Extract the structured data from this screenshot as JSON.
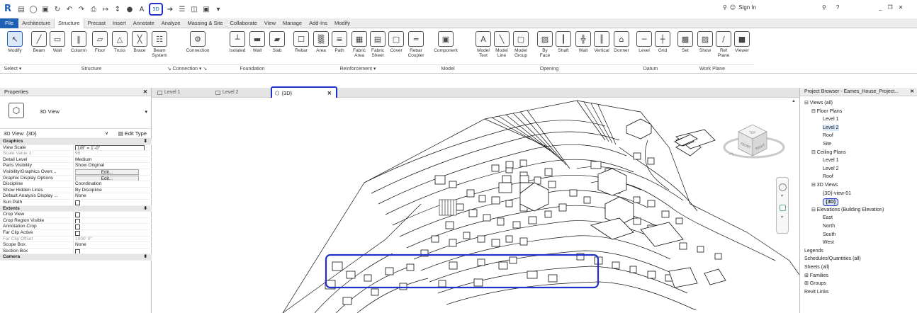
{
  "app": {
    "logo": "R",
    "qa_highlight": "3D",
    "help": "?",
    "sign_in": "Sign In",
    "window_controls": [
      "_",
      "❐",
      "✕"
    ]
  },
  "tabs": [
    "Architecture",
    "Structure",
    "Precast",
    "Insert",
    "Annotate",
    "Analyze",
    "Massing & Site",
    "Collaborate",
    "View",
    "Manage",
    "Add-Ins",
    "Modify"
  ],
  "file_tab": "File",
  "active_tab": "Structure",
  "ribbon": {
    "items": [
      {
        "label": "Modify",
        "icon": "↖"
      },
      {
        "label": "Beam",
        "icon": "╱"
      },
      {
        "label": "Wall",
        "icon": "▭"
      },
      {
        "label": "Column",
        "icon": "‖"
      },
      {
        "label": "Floor",
        "icon": "▱"
      },
      {
        "label": "Truss",
        "icon": "△"
      },
      {
        "label": "Brace",
        "icon": "╳"
      },
      {
        "label": "Beam\nSystem",
        "icon": "☷"
      },
      {
        "label": "Connection",
        "icon": "⚙"
      },
      {
        "label": "Isolated",
        "icon": "┴"
      },
      {
        "label": "Wall",
        "icon": "▬"
      },
      {
        "label": "Slab",
        "icon": "▰"
      },
      {
        "label": "Rebar",
        "icon": "☐"
      },
      {
        "label": "Area",
        "icon": "▒"
      },
      {
        "label": "Path",
        "icon": "≡"
      },
      {
        "label": "Fabric\nArea",
        "icon": "▦"
      },
      {
        "label": "Fabric\nSheet",
        "icon": "▤"
      },
      {
        "label": "Cover",
        "icon": "□"
      },
      {
        "label": "Rebar\nCoupler",
        "icon": "═"
      },
      {
        "label": "Component",
        "icon": "▣"
      },
      {
        "label": "Model\nText",
        "icon": "A"
      },
      {
        "label": "Model\nLine",
        "icon": "╲"
      },
      {
        "label": "Model\nGroup",
        "icon": "▢"
      },
      {
        "label": "By\nFace",
        "icon": "▧"
      },
      {
        "label": "Shaft",
        "icon": "┃"
      },
      {
        "label": "Wall",
        "icon": "╬"
      },
      {
        "label": "Vertical",
        "icon": "║"
      },
      {
        "label": "Dormer",
        "icon": "⌂"
      },
      {
        "label": "Level",
        "icon": "─"
      },
      {
        "label": "Grid",
        "icon": "┼"
      },
      {
        "label": "Set",
        "icon": "▩"
      },
      {
        "label": "Show",
        "icon": "▨"
      },
      {
        "label": "Ref\nPlane",
        "icon": "∕"
      },
      {
        "label": "Viewer",
        "icon": "■"
      }
    ],
    "groups": [
      {
        "label": "Select ▾"
      },
      {
        "label": "Structure"
      },
      {
        "label": "↘ Connection ▾ ↘"
      },
      {
        "label": "Foundation"
      },
      {
        "label": "Reinforcement ▾"
      },
      {
        "label": "Model"
      },
      {
        "label": "Opening"
      },
      {
        "label": "Datum"
      },
      {
        "label": "Work Plane"
      }
    ]
  },
  "properties": {
    "title": "Properties",
    "close": "✕",
    "type_name": "3D View",
    "instance": "3D View: {3D}",
    "edit_type": "Edit Type",
    "rows": [
      {
        "k": "Graphics",
        "v": "",
        "sec": true
      },
      {
        "k": "View Scale",
        "v": "1/8\" = 1'-0\"",
        "kind": "box"
      },
      {
        "k": "Scale Value    1:",
        "v": "96",
        "grey": true
      },
      {
        "k": "Detail Level",
        "v": "Medium"
      },
      {
        "k": "Parts Visibility",
        "v": "Show Original"
      },
      {
        "k": "Visibility/Graphics Overr...",
        "v": "Edit...",
        "kind": "btn"
      },
      {
        "k": "Graphic Display Options",
        "v": "Edit...",
        "kind": "btn"
      },
      {
        "k": "Discipline",
        "v": "Coordination"
      },
      {
        "k": "Show Hidden Lines",
        "v": "By Discipline"
      },
      {
        "k": "Default Analysis Display ...",
        "v": "None"
      },
      {
        "k": "Sun Path",
        "v": "",
        "kind": "cb"
      },
      {
        "k": "Extents",
        "v": "",
        "sec": true
      },
      {
        "k": "Crop View",
        "v": "",
        "kind": "cb"
      },
      {
        "k": "Crop Region Visible",
        "v": "",
        "kind": "cb"
      },
      {
        "k": "Annotation Crop",
        "v": "",
        "kind": "cb"
      },
      {
        "k": "Far Clip Active",
        "v": "",
        "kind": "cb"
      },
      {
        "k": "Far Clip Offset",
        "v": "1000'  0\"",
        "grey": true
      },
      {
        "k": "Scope Box",
        "v": "None"
      },
      {
        "k": "Section Box",
        "v": "",
        "kind": "cb"
      },
      {
        "k": "Camera",
        "v": "",
        "sec": true
      }
    ]
  },
  "doc_tabs": [
    {
      "label": "Level 1"
    },
    {
      "label": "Level 2"
    },
    {
      "label": "{3D}",
      "active": true,
      "close": "✕"
    }
  ],
  "browser": {
    "title": "Project Browser - Eames_House_Project...",
    "close": "✕",
    "nodes": [
      {
        "label": "⊟  Views (all)",
        "level": 0
      },
      {
        "label": "⊟  Floor Plans",
        "level": 1
      },
      {
        "label": "Level 1",
        "level": 2
      },
      {
        "label": "Level 2",
        "level": 2,
        "hi": true
      },
      {
        "label": "Roof",
        "level": 2
      },
      {
        "label": "Site",
        "level": 2
      },
      {
        "label": "⊟  Ceiling Plans",
        "level": 1
      },
      {
        "label": "Level 1",
        "level": 2
      },
      {
        "label": "Level 2",
        "level": 2
      },
      {
        "label": "Roof",
        "level": 2
      },
      {
        "label": "⊟  3D Views",
        "level": 1
      },
      {
        "label": "{3D}-view-01",
        "level": 2
      },
      {
        "label": "{3D}",
        "level": 2,
        "sel": true
      },
      {
        "label": "⊟  Elevations (Building Elevation)",
        "level": 1
      },
      {
        "label": "East",
        "level": 2
      },
      {
        "label": "North",
        "level": 2
      },
      {
        "label": "South",
        "level": 2
      },
      {
        "label": "West",
        "level": 2
      },
      {
        "label": "Legends",
        "level": 0
      },
      {
        "label": "Schedules/Quantities (all)",
        "level": 0
      },
      {
        "label": "Sheets (all)",
        "level": 0
      },
      {
        "label": "⊞  Families",
        "level": 0
      },
      {
        "label": "⊞  Groups",
        "level": 0
      },
      {
        "label": "Revit Links",
        "level": 0
      }
    ]
  },
  "viewcube": {
    "face_left": "FRONT",
    "face_right": "RIGHT",
    "top": "TOP"
  }
}
